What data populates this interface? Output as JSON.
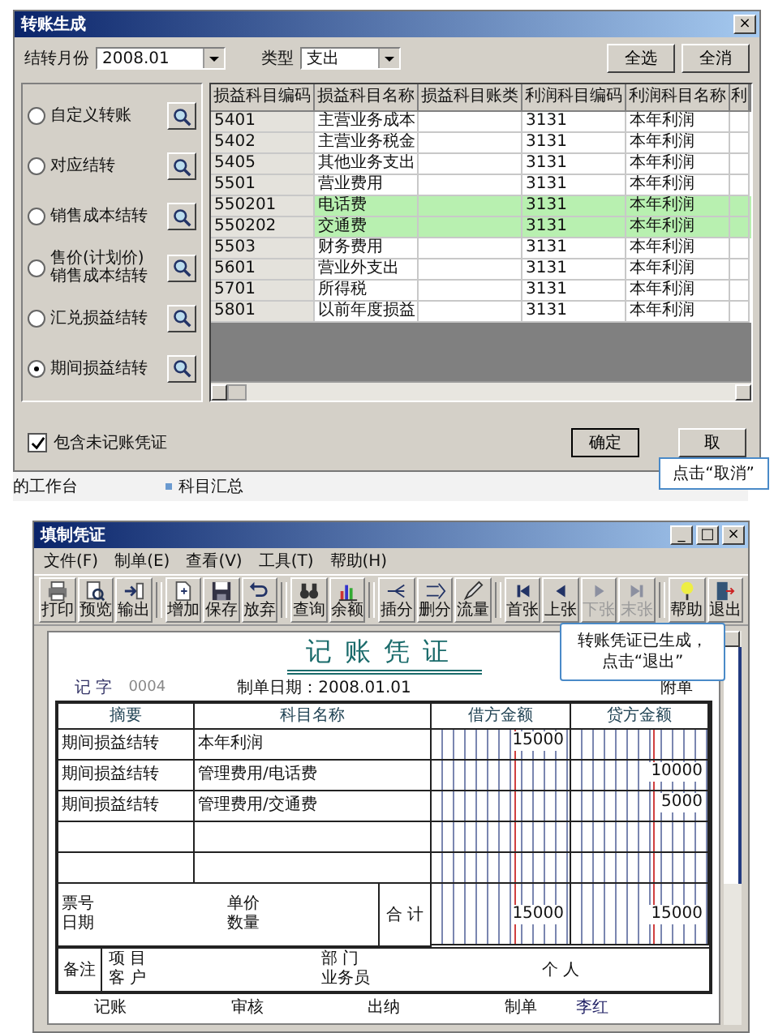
{
  "transfer_dialog": {
    "title": "转账生成",
    "close": "×",
    "month_label": "结转月份",
    "month": "2008.01",
    "type_label": "类型",
    "type": "支出",
    "buttons": [
      "全选",
      "全消"
    ],
    "methods": [
      {
        "label": "自定义转账",
        "selected": false
      },
      {
        "label": "对应结转",
        "selected": false
      },
      {
        "label": "销售成本结转",
        "selected": false
      },
      {
        "label": "售价(计划价) 销售成本结转",
        "selected": false
      },
      {
        "label": "汇兑损益结转",
        "selected": false
      },
      {
        "label": "期间损益结转",
        "selected": true
      }
    ],
    "columns": [
      "损益科目编码",
      "损益科目名称",
      "损益科目账类",
      "利润科目编码",
      "利润科目名称",
      "利"
    ],
    "rows": [
      {
        "cells": [
          "5401",
          "主营业务成本",
          "",
          "3131",
          "本年利润"
        ],
        "selected": false
      },
      {
        "cells": [
          "5402",
          "主营业务税金",
          "",
          "3131",
          "本年利润"
        ],
        "selected": false
      },
      {
        "cells": [
          "5405",
          "其他业务支出",
          "",
          "3131",
          "本年利润"
        ],
        "selected": false
      },
      {
        "cells": [
          "5501",
          "营业费用",
          "",
          "3131",
          "本年利润"
        ],
        "selected": false
      },
      {
        "cells": [
          "550201",
          "电话费",
          "",
          "3131",
          "本年利润"
        ],
        "selected": true
      },
      {
        "cells": [
          "550202",
          "交通费",
          "",
          "3131",
          "本年利润"
        ],
        "selected": true
      },
      {
        "cells": [
          "5503",
          "财务费用",
          "",
          "3131",
          "本年利润"
        ],
        "selected": false
      },
      {
        "cells": [
          "5601",
          "营业外支出",
          "",
          "3131",
          "本年利润"
        ],
        "selected": false
      },
      {
        "cells": [
          "5701",
          "所得税",
          "",
          "3131",
          "本年利润"
        ],
        "selected": false
      },
      {
        "cells": [
          "5801",
          "以前年度损益",
          "",
          "3131",
          "本年利润"
        ],
        "selected": false
      }
    ],
    "include_unposted": {
      "label": "包含未记账凭证",
      "checked": true
    },
    "ok": "确定",
    "cancel": "取",
    "callout": "点击“取消”"
  },
  "workbench_strip": {
    "label": "的工作台",
    "items": [
      "科目汇总"
    ]
  },
  "voucher_window": {
    "title": "填制凭证",
    "window_buttons": [
      "_",
      "□",
      "×"
    ],
    "menu": [
      "文件(F)",
      "制单(E)",
      "查看(V)",
      "工具(T)",
      "帮助(H)"
    ],
    "toolbar": [
      [
        {
          "label": "打印",
          "disabled": false
        },
        {
          "label": "预览",
          "disabled": false
        },
        {
          "label": "输出",
          "disabled": false
        }
      ],
      [
        {
          "label": "增加",
          "disabled": false
        },
        {
          "label": "保存",
          "disabled": false
        },
        {
          "label": "放弃",
          "disabled": false
        }
      ],
      [
        {
          "label": "查询",
          "disabled": false
        },
        {
          "label": "余额",
          "disabled": false
        }
      ],
      [
        {
          "label": "插分",
          "disabled": false
        },
        {
          "label": "删分",
          "disabled": false
        },
        {
          "label": "流量",
          "disabled": false
        }
      ],
      [
        {
          "label": "首张",
          "disabled": false
        },
        {
          "label": "上张",
          "disabled": false
        },
        {
          "label": "下张",
          "disabled": true
        },
        {
          "label": "末张",
          "disabled": true
        }
      ],
      [
        {
          "label": "帮助",
          "disabled": false
        },
        {
          "label": "退出",
          "disabled": false
        }
      ]
    ],
    "callout": [
      "转账凭证已生成，",
      "点击“退出”"
    ],
    "voucher": {
      "title": "记账凭证",
      "type_label": "记 字",
      "number": "0004",
      "date": "制单日期：2008.01.01",
      "attach": "附单",
      "columns": [
        "摘要",
        "科目名称",
        "借方金额",
        "贷方金额"
      ],
      "rows": [
        {
          "summary": "期间损益结转",
          "account": "本年利润",
          "debit": "15000"
        },
        {
          "summary": "期间损益结转",
          "account": "管理费用/电话费",
          "credit": "10000"
        },
        {
          "summary": "期间损益结转",
          "account": "管理费用/交通费",
          "credit": "5000"
        }
      ],
      "ticket_label": "票号",
      "date_label": "日期",
      "unit_price_label": "单价",
      "quantity_label": "数量",
      "total_label": "合 计",
      "total_debit": "15000",
      "total_credit": "15000",
      "remark_label": "备注",
      "project_label": "项 目",
      "customer_label": "客 户",
      "department_label": "部 门",
      "salesperson_label": "业务员",
      "personal_label": "个 人",
      "signatures": [
        {
          "label": "记账"
        },
        {
          "label": "审核"
        },
        {
          "label": "出纳"
        },
        {
          "label": "制单",
          "name": "李红"
        }
      ]
    }
  }
}
